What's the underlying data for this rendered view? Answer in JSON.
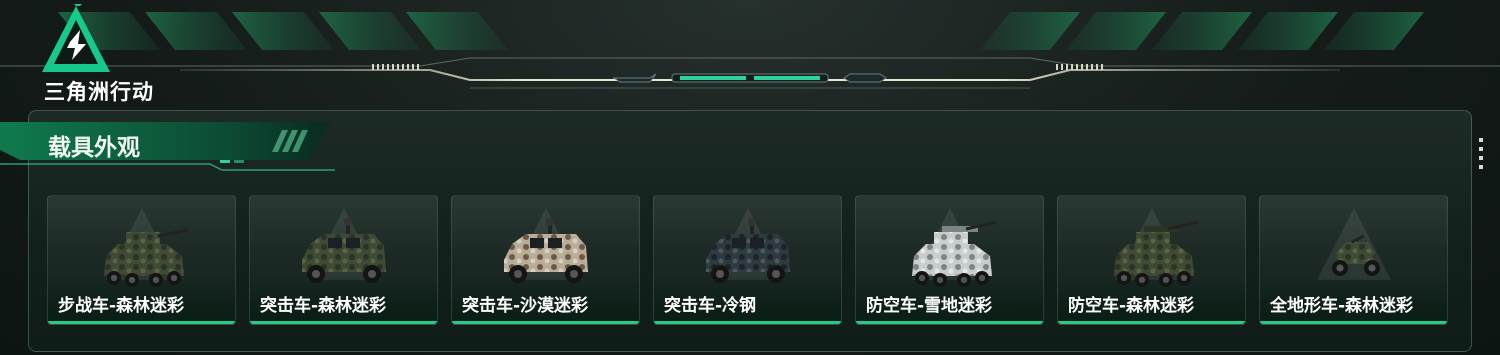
{
  "app": {
    "title": "三角洲行动"
  },
  "section": {
    "title": "载具外观"
  },
  "colors": {
    "accent": "#25c98a",
    "panel_bg": "#12201b",
    "header_bg": "#1d2422"
  },
  "vehicles": [
    {
      "name": "步战车-森林迷彩",
      "icon": "ifv-icon",
      "camo": "forest"
    },
    {
      "name": "突击车-森林迷彩",
      "icon": "assault-vehicle-icon",
      "camo": "forest"
    },
    {
      "name": "突击车-沙漠迷彩",
      "icon": "assault-vehicle-icon",
      "camo": "desert"
    },
    {
      "name": "突击车-冷钢",
      "icon": "assault-vehicle-icon",
      "camo": "steel"
    },
    {
      "name": "防空车-雪地迷彩",
      "icon": "aa-vehicle-icon",
      "camo": "snow"
    },
    {
      "name": "防空车-森林迷彩",
      "icon": "aa-vehicle-icon",
      "camo": "forest"
    },
    {
      "name": "全地形车-森林迷彩",
      "icon": "atv-icon",
      "camo": "forest"
    }
  ]
}
